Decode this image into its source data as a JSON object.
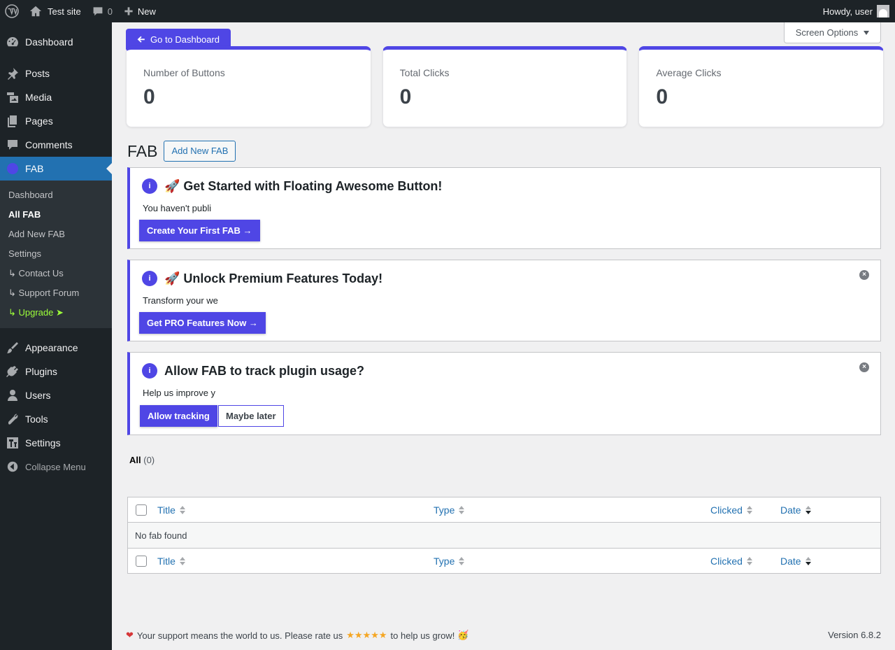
{
  "adminbar": {
    "site_name": "Test site",
    "comments_count": "0",
    "new_label": "New",
    "howdy": "Howdy, user"
  },
  "sidebar": {
    "items": [
      {
        "label": "Dashboard",
        "icon": "dashboard-icon"
      },
      {
        "label": "Posts",
        "icon": "pin-icon"
      },
      {
        "label": "Media",
        "icon": "media-icon"
      },
      {
        "label": "Pages",
        "icon": "pages-icon"
      },
      {
        "label": "Comments",
        "icon": "comment-icon"
      },
      {
        "label": "FAB",
        "icon": "fab-icon"
      }
    ],
    "submenu": [
      {
        "label": "Dashboard"
      },
      {
        "label": "All FAB"
      },
      {
        "label": "Add New FAB"
      },
      {
        "label": "Settings"
      },
      {
        "label": "↳ Contact Us"
      },
      {
        "label": "↳ Support Forum"
      },
      {
        "label": "↳ Upgrade  ➤"
      }
    ],
    "items2": [
      {
        "label": "Appearance",
        "icon": "brush-icon"
      },
      {
        "label": "Plugins",
        "icon": "plug-icon"
      },
      {
        "label": "Users",
        "icon": "user-icon"
      },
      {
        "label": "Tools",
        "icon": "wrench-icon"
      },
      {
        "label": "Settings",
        "icon": "settings-icon"
      }
    ],
    "collapse": "Collapse Menu"
  },
  "main": {
    "go_dashboard": "Go to Dashboard",
    "screen_options": "Screen Options",
    "stats": [
      {
        "label": "Number of Buttons",
        "value": "0"
      },
      {
        "label": "Total Clicks",
        "value": "0"
      },
      {
        "label": "Average Clicks",
        "value": "0"
      }
    ],
    "page_title": "FAB",
    "add_new": "Add New FAB",
    "notices": [
      {
        "title": "🚀 Get Started with Floating Awesome Button!",
        "text": "You haven't publi",
        "button": "Create Your First FAB →"
      },
      {
        "title": "🚀 Unlock Premium Features Today!",
        "text": "Transform your we",
        "button": "Get PRO Features Now →"
      },
      {
        "title": "Allow FAB to track plugin usage?",
        "text": "Help us improve y",
        "button": "Allow tracking",
        "button2": "Maybe later"
      }
    ],
    "filter": {
      "label": "All",
      "count": "(0)"
    },
    "table": {
      "columns": [
        "Title",
        "Type",
        "Clicked",
        "Date"
      ],
      "empty": "No fab found"
    }
  },
  "footer": {
    "text_before": "Your support means the world to us. Please rate us",
    "stars": "★★★★★",
    "text_after": "to help us grow!",
    "party": "🥳",
    "version": "Version 6.8.2"
  },
  "colors": {
    "accent": "#4f46e5",
    "wp_blue": "#2271b1",
    "admin_dark": "#1d2327"
  }
}
